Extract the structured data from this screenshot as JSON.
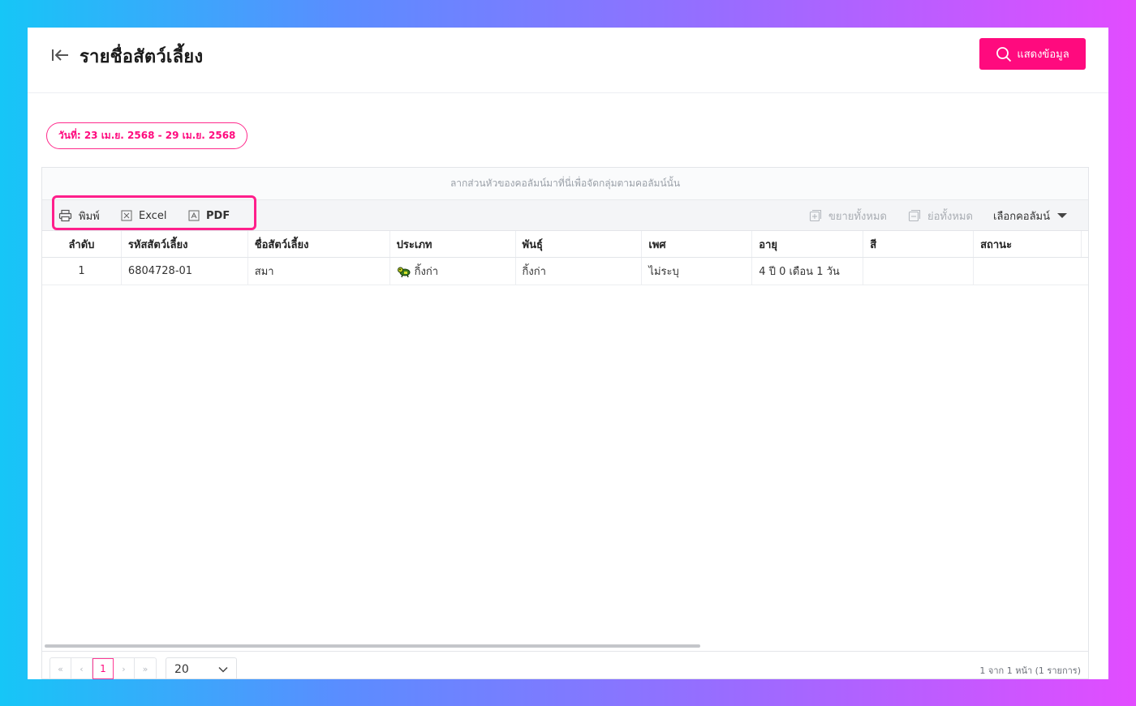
{
  "header": {
    "title": "รายชื่อสัตว์เลี้ยง",
    "show_button_label": "แสดงข้อมูล"
  },
  "filter": {
    "date_range": "วันที่: 23 เม.ย. 2568 - 29 เม.ย. 2568"
  },
  "grid": {
    "group_panel_hint": "ลากส่วนหัวของคอลัมน์มาที่นี่เพื่อจัดกลุ่มตามคอลัมน์นั้น",
    "toolbar": {
      "print_label": "พิมพ์",
      "excel_label": "Excel",
      "pdf_label": "PDF",
      "expand_all_label": "ขยายทั้งหมด",
      "collapse_all_label": "ย่อทั้งหมด",
      "column_chooser_label": "เลือกคอลัมน์"
    },
    "columns": [
      "ลำดับ",
      "รหัสสัตว์เลี้ยง",
      "ชื่อสัตว์เลี้ยง",
      "ประเภท",
      "พันธุ์",
      "เพศ",
      "อายุ",
      "สี",
      "สถานะ"
    ],
    "rows": [
      {
        "no": "1",
        "pet_id": "6804728-01",
        "pet_name": "สมา",
        "type": "กิ้งก่า",
        "type_icon": "lizard-icon",
        "breed": "กิ้งก่า",
        "sex": "ไม่ระบุ",
        "age": "4 ปี 0 เดือน 1 วัน",
        "color": "",
        "status": ""
      }
    ],
    "pager": {
      "first": "«",
      "prev": "‹",
      "current_page": "1",
      "next": "›",
      "last": "»",
      "page_size": "20",
      "info": "1 จาก 1 หน้า (1 รายการ)"
    }
  },
  "colors": {
    "accent": "#ff0a7e"
  }
}
